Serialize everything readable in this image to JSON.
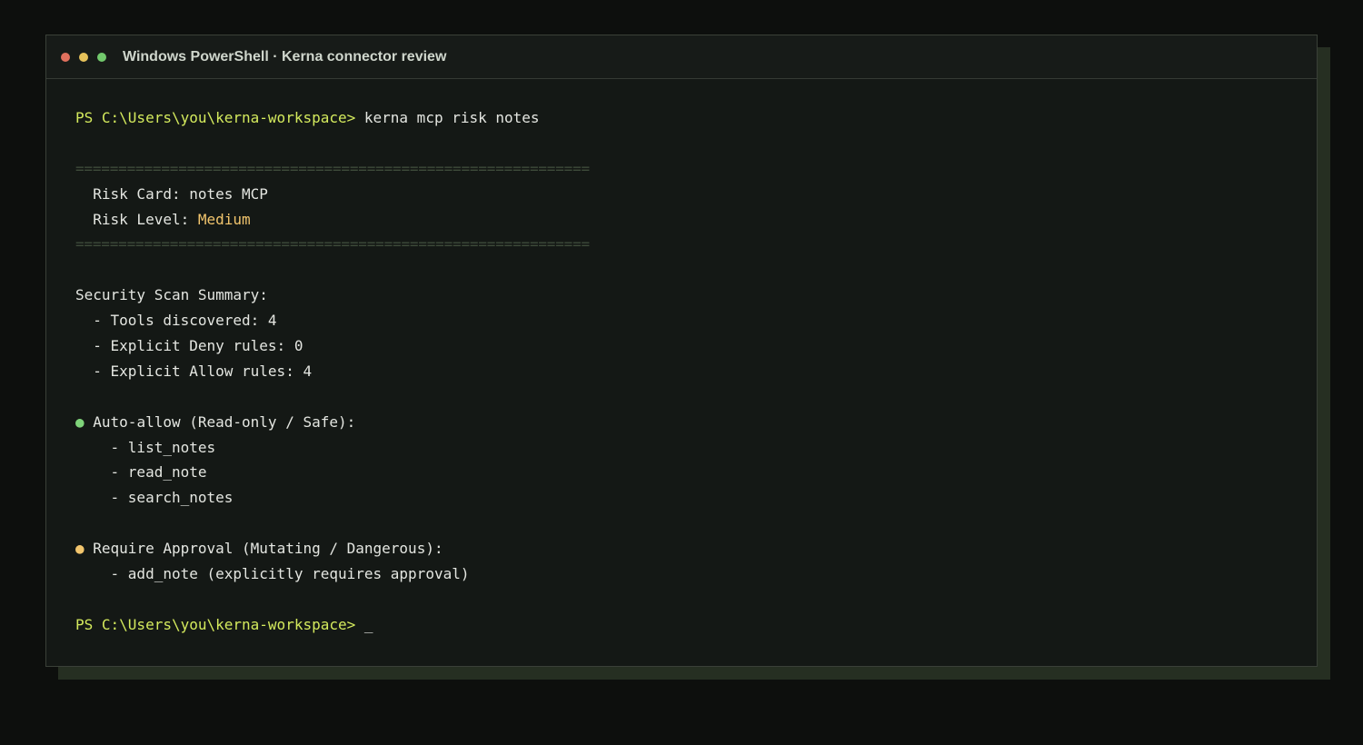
{
  "window": {
    "title": "Windows PowerShell · Kerna connector review",
    "controls": [
      {
        "name": "close",
        "color": "#e0705d"
      },
      {
        "name": "minimize",
        "color": "#e6c25a"
      },
      {
        "name": "maximize",
        "color": "#72c96c"
      }
    ]
  },
  "terminal": {
    "prompt": "PS C:\\Users\\you\\kerna-workspace>",
    "command": " kerna mcp risk notes",
    "rule": "============================================================",
    "risk_card_label": "  Risk Card: notes MCP",
    "risk_level_label": "  Risk Level: ",
    "risk_level_value": "Medium",
    "summary_heading": "Security Scan Summary:",
    "summary_items": [
      "  - Tools discovered: 4",
      "  - Explicit Deny rules: 0",
      "  - Explicit Allow rules: 4"
    ],
    "auto_allow": {
      "bullet": "●",
      "bullet_color": "#7fd47a",
      "heading": " Auto-allow (Read-only / Safe):",
      "items": [
        "    - list_notes",
        "    - read_note",
        "    - search_notes"
      ]
    },
    "require_approval": {
      "bullet": "●",
      "bullet_color": "#f2c56d",
      "heading": " Require Approval (Mutating / Dangerous):",
      "items": [
        "    - add_note (explicitly requires approval)"
      ]
    },
    "cursor": " _"
  }
}
